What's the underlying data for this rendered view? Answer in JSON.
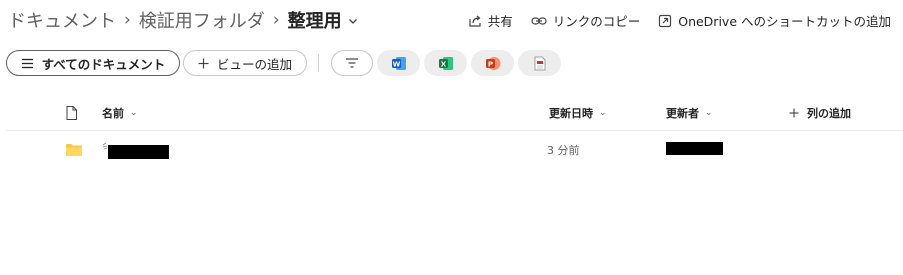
{
  "breadcrumb": {
    "items": [
      "ドキュメント",
      "検証用フォルダ"
    ],
    "current": "整理用"
  },
  "actions": {
    "share": "共有",
    "copy_link": "リンクのコピー",
    "add_shortcut": "OneDrive へのショートカットの追加"
  },
  "toolbar": {
    "view_all": "すべてのドキュメント",
    "add_view": "ビューの追加",
    "file_type_chips": [
      "word-icon",
      "excel-icon",
      "powerpoint-icon",
      "pdf-icon"
    ]
  },
  "table": {
    "columns": {
      "name": "名前",
      "modified": "更新日時",
      "modified_by": "更新者",
      "add_column": "列の追加"
    },
    "rows": [
      {
        "name": "",
        "modified": "3 分前",
        "modified_by": "",
        "icon": "folder-icon"
      }
    ]
  },
  "colors": {
    "word": "#185abd",
    "excel": "#107c41",
    "powerpoint": "#c43e1c",
    "pdf": "#d13438",
    "folder": "#f8c84a"
  }
}
